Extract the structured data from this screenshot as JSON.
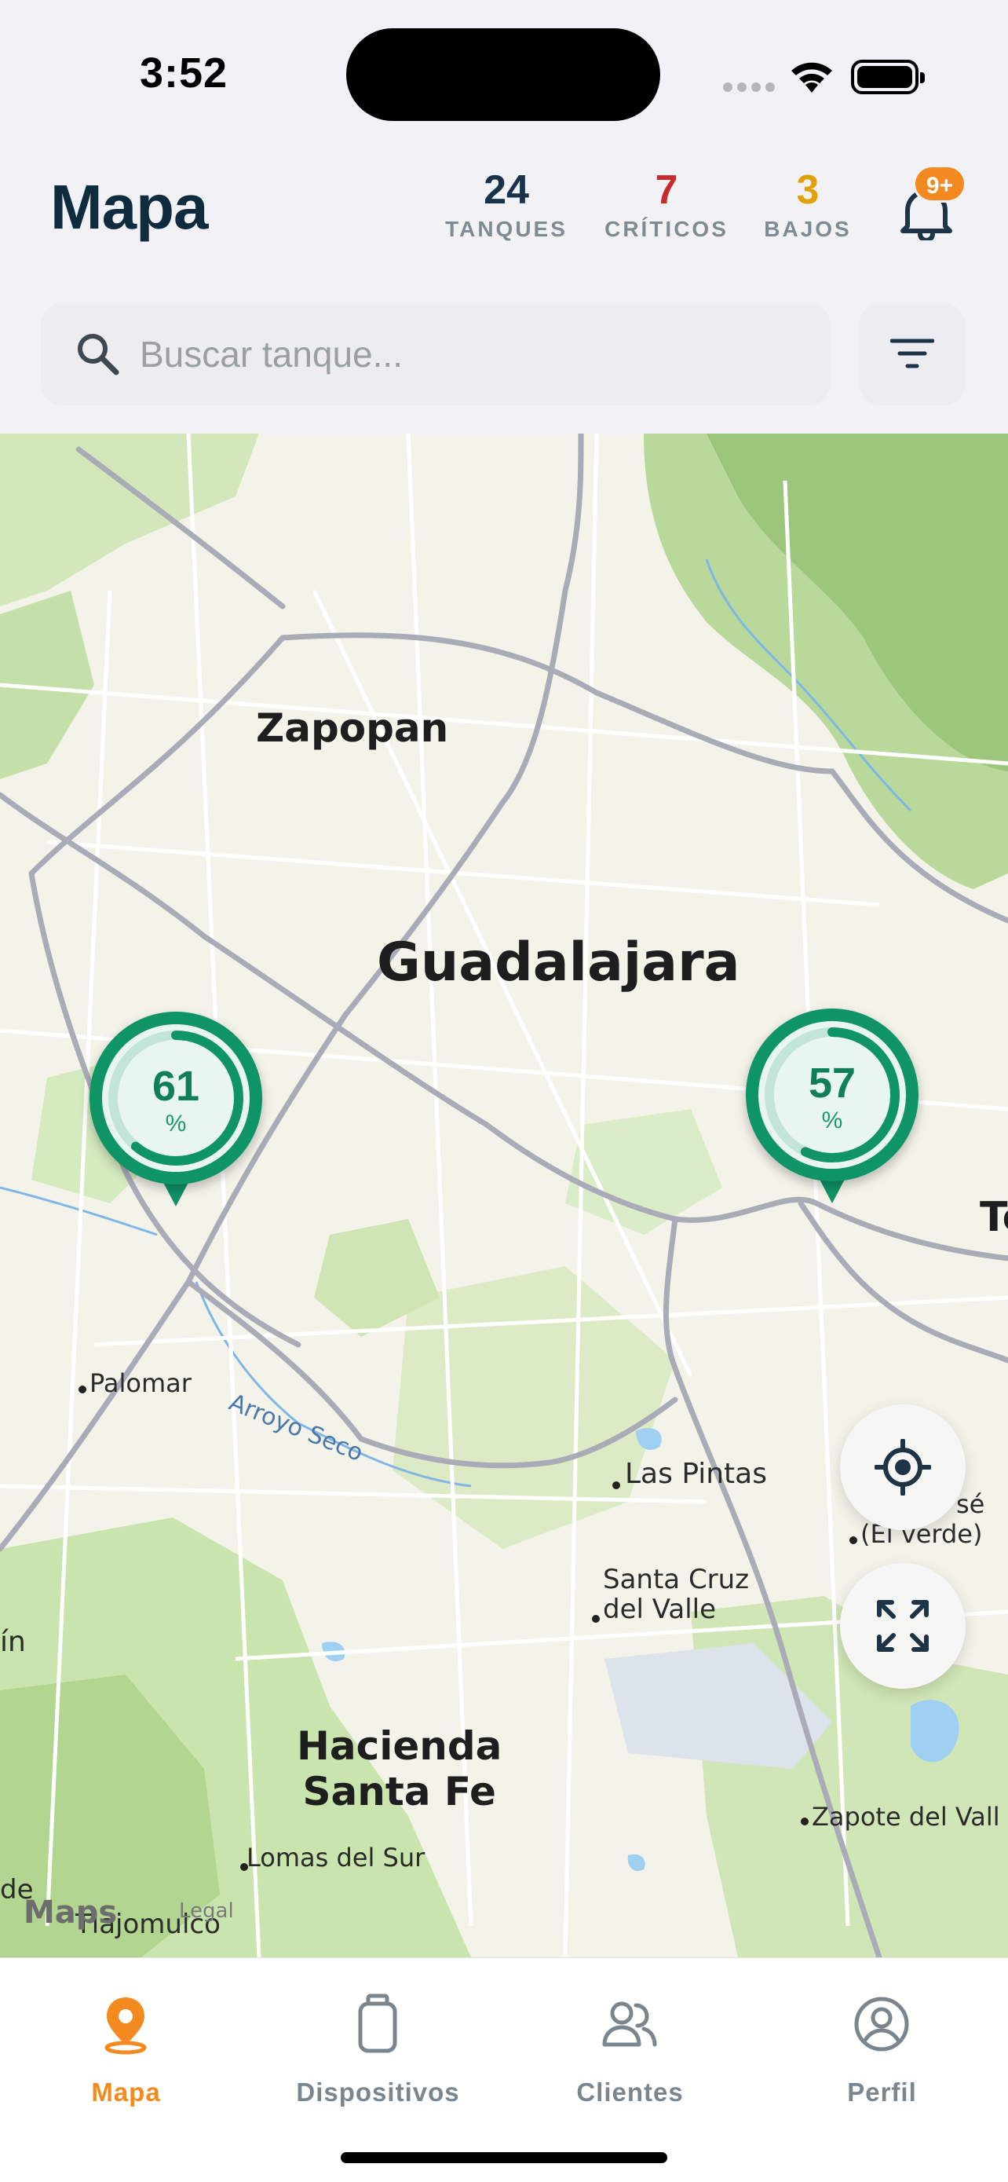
{
  "status_bar": {
    "time": "3:52"
  },
  "header": {
    "title": "Mapa",
    "stats": [
      {
        "value": "24",
        "label": "TANQUES",
        "color": "#17324a"
      },
      {
        "value": "7",
        "label": "CRÍTICOS",
        "color": "#c72b2b"
      },
      {
        "value": "3",
        "label": "BAJOS",
        "color": "#e0a10a"
      }
    ],
    "notifications_badge": "9+"
  },
  "search": {
    "placeholder": "Buscar tanque..."
  },
  "map": {
    "labels": {
      "zapopan": "Zapopan",
      "guadalajara": "Guadalajara",
      "palomar": "Palomar",
      "arroyo": "Arroyo Seco",
      "pintas": "Las Pintas",
      "santacruz_1": "Santa Cruz",
      "santacruz_2": "del Valle",
      "hacienda_1": "Hacienda",
      "hacienda_2": "Santa Fe",
      "lomas": "Lomas del Sur",
      "zapote": "Zapote del Vall",
      "tlajomulco": "Tlajomulco",
      "verde": "(El verde)",
      "jose": "sé",
      "in": "ín",
      "de": "de",
      "t": "To",
      "attribution": "Maps",
      "legal": "Legal"
    },
    "tank_pins": [
      {
        "value": "61",
        "unit": "%",
        "level": 0.61,
        "color": "#0f9466"
      },
      {
        "value": "57",
        "unit": "%",
        "level": 0.57,
        "color": "#0f9466"
      }
    ]
  },
  "tabbar": {
    "tabs": [
      {
        "label": "Mapa",
        "icon": "map-pin-icon",
        "active": true
      },
      {
        "label": "Dispositivos",
        "icon": "gas-tank-icon",
        "active": false
      },
      {
        "label": "Clientes",
        "icon": "users-icon",
        "active": false
      },
      {
        "label": "Perfil",
        "icon": "profile-icon",
        "active": false
      }
    ],
    "active_color": "#f28a1f"
  }
}
